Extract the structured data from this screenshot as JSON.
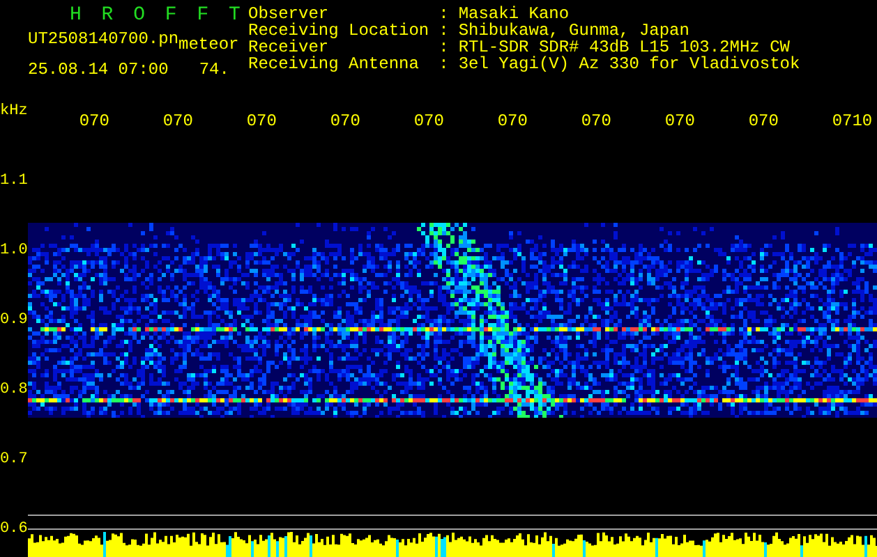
{
  "header": {
    "title": "H R O F F T",
    "file_name": "UT2508140700.pn",
    "mode": "meteor",
    "date_time": "25.08.14 07:00",
    "count": "74.",
    "info": [
      {
        "label": "Observer",
        "separator": ":",
        "value": "Masaki Kano"
      },
      {
        "label": "Receiving Location",
        "separator": ":",
        "value": "Shibukawa, Gunma, Japan"
      },
      {
        "label": "Receiver",
        "separator": ":",
        "value": "RTL-SDR SDR# 43dB L15 103.2MHz CW"
      },
      {
        "label": "Receiving Antenna",
        "separator": ":",
        "value": "3el Yagi(V) Az 330 for Vladivostok"
      }
    ]
  },
  "y_axis": {
    "unit": "kHz",
    "labels": [
      "1.1",
      "1.0",
      "0.9",
      "0.8",
      "0.7",
      "0.6"
    ]
  },
  "time_axis": {
    "labels": [
      "070",
      "070",
      "070",
      "070",
      "070",
      "070",
      "070",
      "070",
      "070",
      "0710"
    ]
  }
}
